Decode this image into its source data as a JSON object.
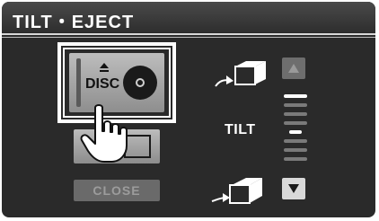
{
  "header": {
    "title": "TILT・EJECT"
  },
  "disc_button": {
    "label": "DISC",
    "icon": "eject-icon"
  },
  "close_button": {
    "label": "CLOSE",
    "enabled": false
  },
  "tilt": {
    "label": "TILT",
    "up_icon": "tilt-up-icon",
    "down_icon": "tilt-down-icon",
    "level_total": 8,
    "level_current": 4
  },
  "colors": {
    "background": "#2a2a2a",
    "button_face": "#a8a8a8",
    "highlight": "#ffffff",
    "disabled": "#6a6a6a"
  }
}
